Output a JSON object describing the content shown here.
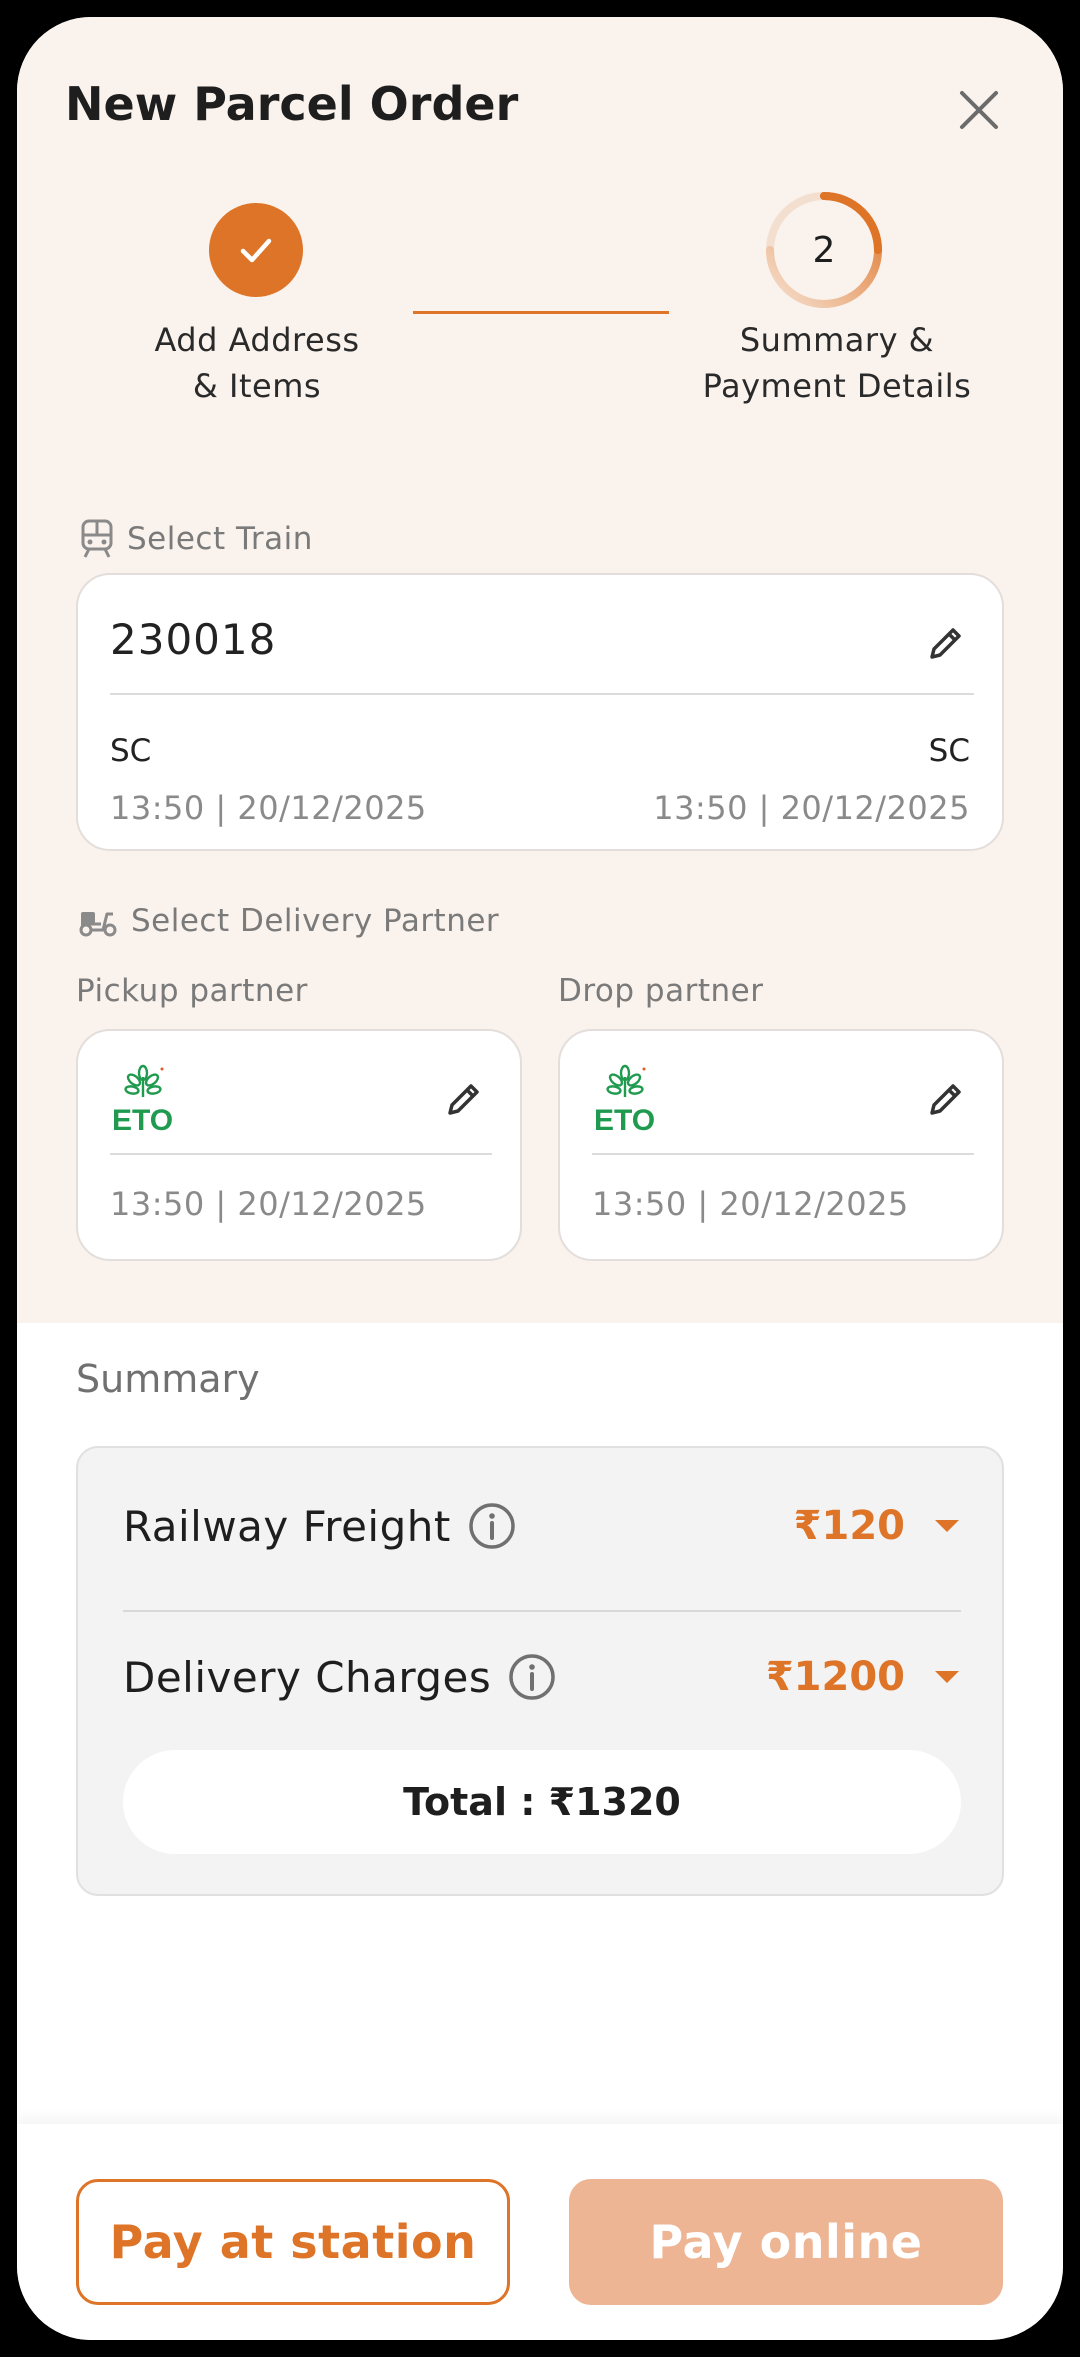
{
  "header": {
    "title": "New Parcel Order",
    "steps": [
      {
        "label_line1": "Add Address",
        "label_line2": "& Items",
        "status": "done"
      },
      {
        "number": "2",
        "label_line1": "Summary &",
        "label_line2": "Payment Details",
        "status": "current"
      }
    ]
  },
  "train": {
    "section_label": "Select Train",
    "number": "230018",
    "from": {
      "station": "SC",
      "time": "13:50 | 20/12/2025"
    },
    "to": {
      "station": "SC",
      "time": "13:50 | 20/12/2025"
    }
  },
  "delivery": {
    "section_label": "Select Delivery Partner",
    "pickup": {
      "label": "Pickup partner",
      "logo_text": "ETO",
      "time": "13:50 | 20/12/2025"
    },
    "drop": {
      "label": "Drop partner",
      "logo_text": "ETO",
      "time": "13:50 | 20/12/2025"
    }
  },
  "summary": {
    "title": "Summary",
    "items": [
      {
        "label": "Railway Freight",
        "amount": "₹120"
      },
      {
        "label": "Delivery Charges",
        "amount": "₹1200"
      }
    ],
    "total": "Total : ₹1320"
  },
  "actions": {
    "pay_at_station": "Pay at station",
    "pay_online": "Pay online"
  },
  "colors": {
    "accent": "#de7427",
    "accent_disabled": "#edb593",
    "header_bg": "#faf2ec",
    "logo_green": "#1f9a4f"
  },
  "icons": [
    "close-icon",
    "check-icon",
    "train-icon",
    "scooter-icon",
    "pencil-icon",
    "info-icon",
    "caret-down-icon"
  ]
}
